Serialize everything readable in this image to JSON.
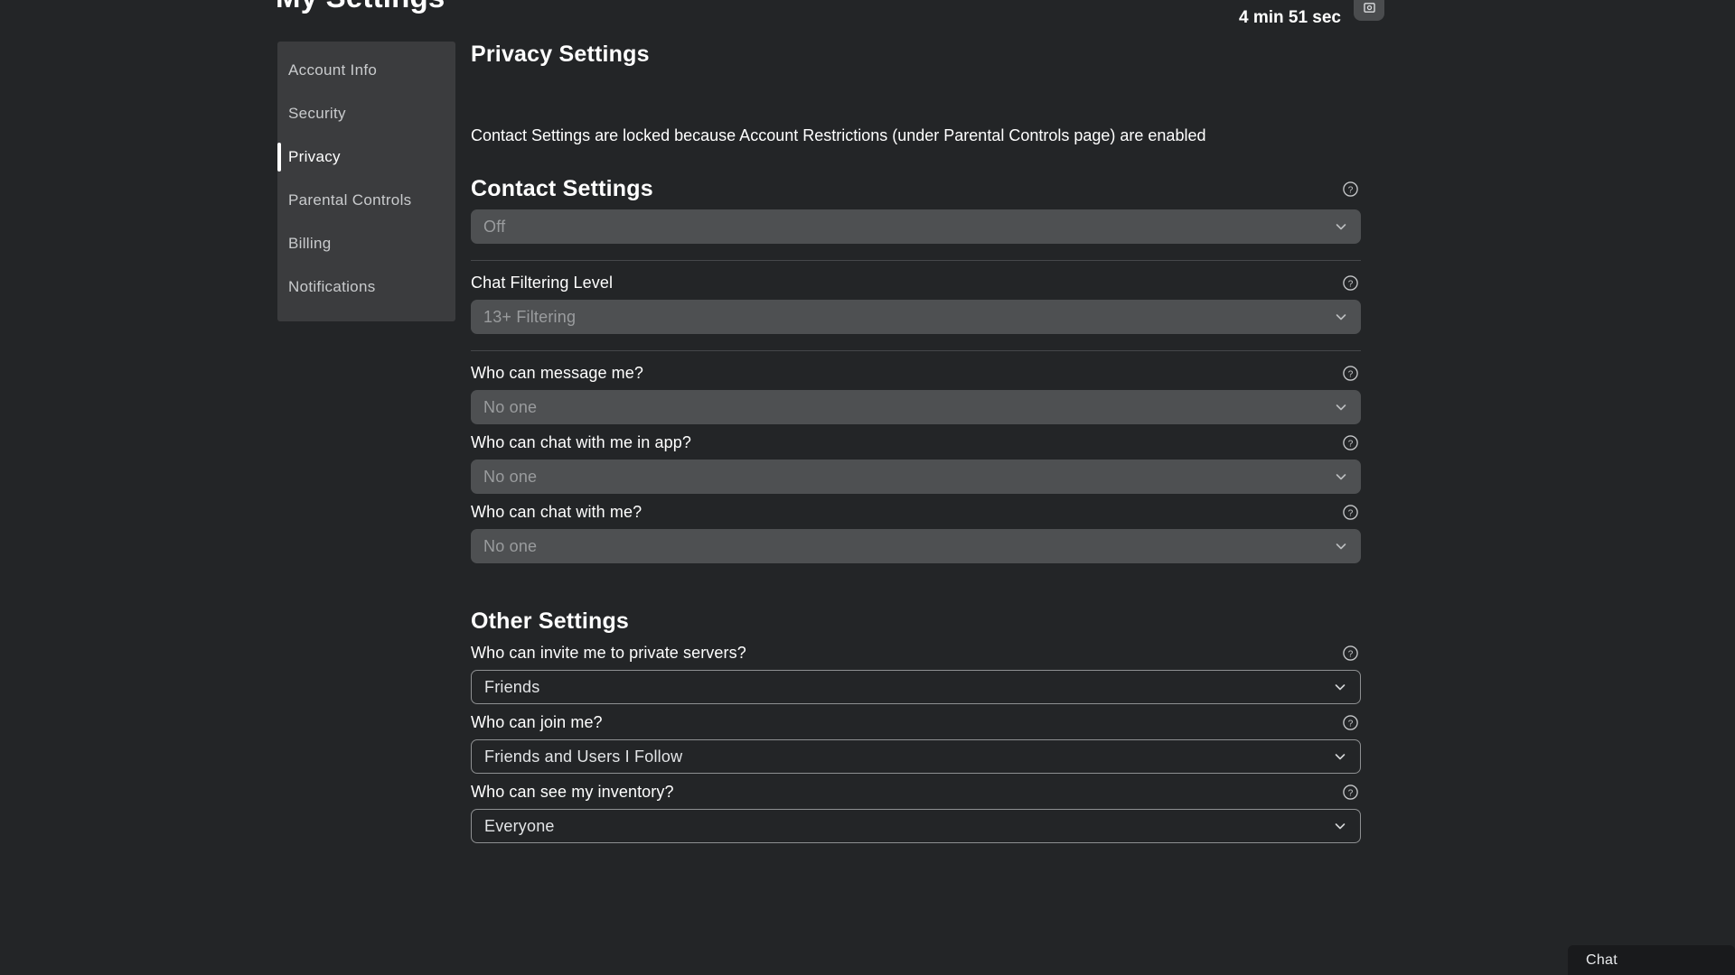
{
  "header": {
    "title": "My Settings",
    "timer": "4 min 51 sec",
    "icon_button": "screenshot-icon"
  },
  "sidebar": {
    "items": [
      {
        "label": "Account Info",
        "active": false
      },
      {
        "label": "Security",
        "active": false
      },
      {
        "label": "Privacy",
        "active": true
      },
      {
        "label": "Parental Controls",
        "active": false
      },
      {
        "label": "Billing",
        "active": false
      },
      {
        "label": "Notifications",
        "active": false
      }
    ]
  },
  "main": {
    "page_heading": "Privacy Settings",
    "lock_note": "Contact Settings are locked because Account Restrictions (under Parental Controls page) are enabled",
    "contact_settings": {
      "heading": "Contact Settings",
      "fields": [
        {
          "label": "",
          "value": "Off",
          "disabled": true,
          "help": "help-icon"
        },
        {
          "label": "Chat Filtering Level",
          "value": "13+ Filtering",
          "disabled": true,
          "help": "help-icon"
        },
        {
          "label": "Who can message me?",
          "value": "No one",
          "disabled": true,
          "help": "help-icon"
        },
        {
          "label": "Who can chat with me in app?",
          "value": "No one",
          "disabled": true,
          "help": "help-icon"
        },
        {
          "label": "Who can chat with me?",
          "value": "No one",
          "disabled": true,
          "help": "help-icon"
        }
      ]
    },
    "other_settings": {
      "heading": "Other Settings",
      "fields": [
        {
          "label": "Who can invite me to private servers?",
          "value": "Friends",
          "disabled": false,
          "help": "help-icon"
        },
        {
          "label": "Who can join me?",
          "value": "Friends and Users I Follow",
          "disabled": false,
          "help": "help-icon"
        },
        {
          "label": "Who can see my inventory?",
          "value": "Everyone",
          "disabled": false,
          "help": "help-icon"
        }
      ]
    }
  },
  "chat_dock": {
    "label": "Chat"
  },
  "colors": {
    "page_background": "#232527",
    "sidebar_background": "#3b3c3e",
    "disabled_field": "#4e5052",
    "enabled_border": "#8e9092",
    "text_primary": "#ffffff",
    "text_muted": "#9a9c9e",
    "active_indicator": "#ffffff",
    "chat_dock": "#191a1c"
  }
}
